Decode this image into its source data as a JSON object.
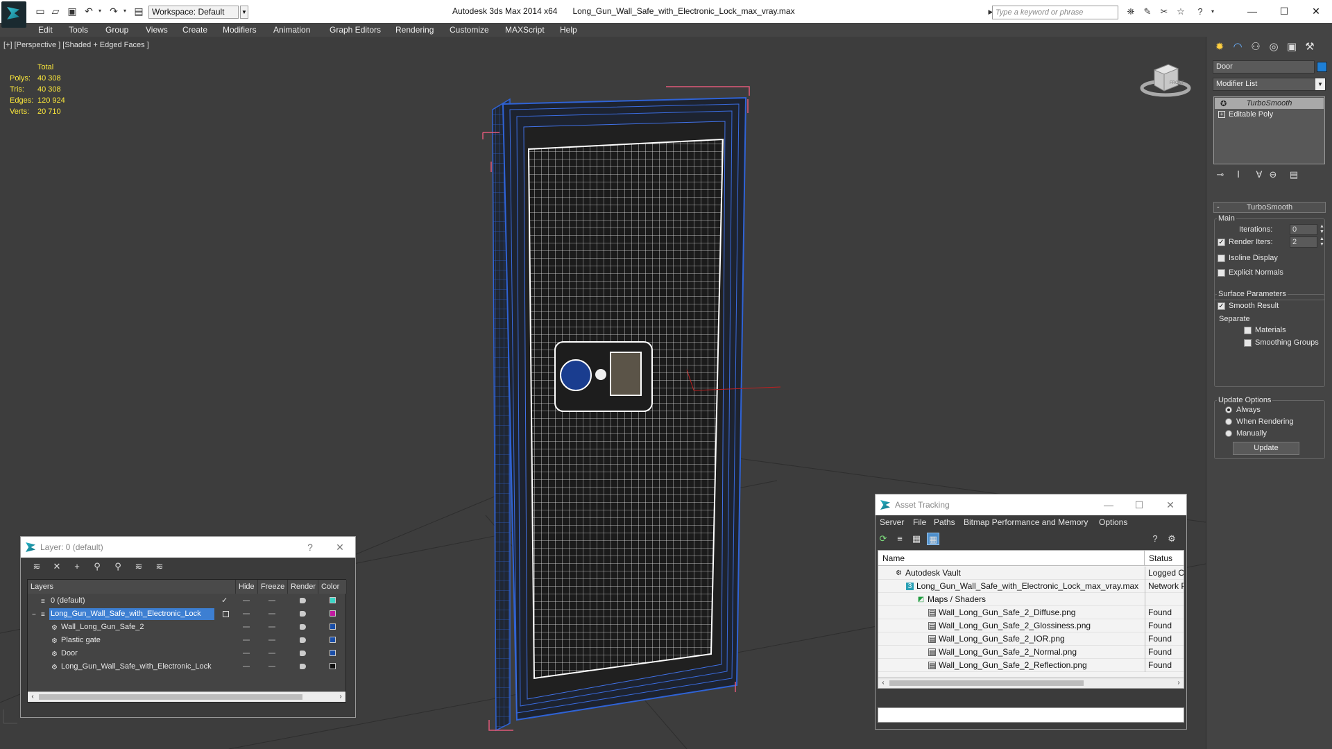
{
  "titlebar": {
    "workspace": "Workspace: Default",
    "app_name": "Autodesk 3ds Max  2014 x64",
    "file_name": "Long_Gun_Wall_Safe_with_Electronic_Lock_max_vray.max",
    "search_placeholder": "Type a keyword or phrase",
    "minimize": "—",
    "maximize": "☐",
    "close": "✕"
  },
  "menu": [
    "Edit",
    "Tools",
    "Group",
    "Views",
    "Create",
    "Modifiers",
    "Animation",
    "Graph Editors",
    "Rendering",
    "Customize",
    "MAXScript",
    "Help"
  ],
  "viewport": {
    "label": "[+] [Perspective ] [Shaded + Edged Faces ]",
    "stats_header": "Total",
    "stats": [
      {
        "key": "Polys:",
        "value": "40 308"
      },
      {
        "key": "Tris:",
        "value": "40 308"
      },
      {
        "key": "Edges:",
        "value": "120 924"
      },
      {
        "key": "Verts:",
        "value": "20 710"
      }
    ],
    "viewcube_label": "FRONT"
  },
  "command_panel": {
    "object_name": "Door",
    "object_color": "#1e7fd6",
    "modifier_list": "Modifier List",
    "stack": [
      "TurboSmooth",
      "Editable Poly"
    ],
    "rollout_title": "TurboSmooth",
    "main_group": "Main",
    "iterations_label": "Iterations:",
    "iterations_value": "0",
    "render_iters_label": "Render Iters:",
    "render_iters_value": "2",
    "isoline_label": "Isoline Display",
    "explicit_normals_label": "Explicit Normals",
    "surface_group": "Surface Parameters",
    "smooth_result_label": "Smooth Result",
    "separate_label": "Separate",
    "materials_label": "Materials",
    "smoothing_groups_label": "Smoothing Groups",
    "update_group": "Update Options",
    "update_always": "Always",
    "update_when_rendering": "When Rendering",
    "update_manually": "Manually",
    "update_button": "Update"
  },
  "layer_window": {
    "title": "Layer: 0 (default)",
    "help": "?",
    "close": "✕",
    "columns": [
      "Layers",
      "Hide",
      "Freeze",
      "Render",
      "Color"
    ],
    "rows": [
      {
        "name": "0 (default)",
        "color": "#3ad6c6",
        "level": 0,
        "active": true
      },
      {
        "name": "Long_Gun_Wall_Safe_with_Electronic_Lock",
        "color": "#c21aa1",
        "level": 0,
        "selected": true
      },
      {
        "name": "Wall_Long_Gun_Safe_2",
        "color": "#1a4ea8",
        "level": 1
      },
      {
        "name": "Plastic gate",
        "color": "#1a4ea8",
        "level": 1
      },
      {
        "name": "Door",
        "color": "#1a4ea8",
        "level": 1
      },
      {
        "name": "Long_Gun_Wall_Safe_with_Electronic_Lock",
        "color": "#111111",
        "level": 1
      }
    ]
  },
  "asset_window": {
    "title": "Asset Tracking",
    "menu": [
      "Server",
      "File",
      "Paths",
      "Bitmap Performance and Memory",
      "Options"
    ],
    "columns": [
      "Name",
      "Status"
    ],
    "rows": [
      {
        "name": "Autodesk Vault",
        "status": "Logged Ou",
        "level": 1
      },
      {
        "name": "Long_Gun_Wall_Safe_with_Electronic_Lock_max_vray.max",
        "status": "Network Pa",
        "level": 2
      },
      {
        "name": "Maps / Shaders",
        "status": "",
        "level": 3
      },
      {
        "name": "Wall_Long_Gun_Safe_2_Diffuse.png",
        "status": "Found",
        "level": 4
      },
      {
        "name": "Wall_Long_Gun_Safe_2_Glossiness.png",
        "status": "Found",
        "level": 4
      },
      {
        "name": "Wall_Long_Gun_Safe_2_IOR.png",
        "status": "Found",
        "level": 4
      },
      {
        "name": "Wall_Long_Gun_Safe_2_Normal.png",
        "status": "Found",
        "level": 4
      },
      {
        "name": "Wall_Long_Gun_Safe_2_Reflection.png",
        "status": "Found",
        "level": 4
      }
    ]
  }
}
